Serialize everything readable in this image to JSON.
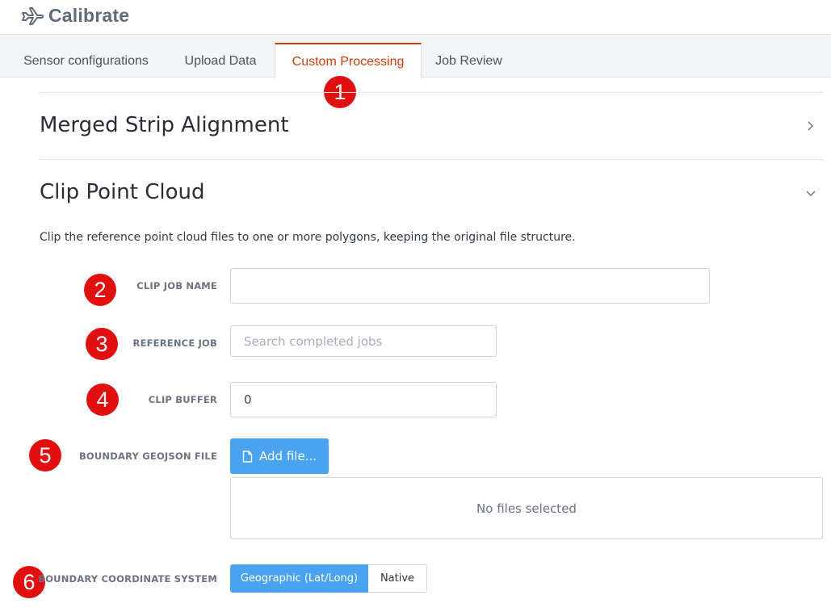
{
  "app": {
    "title": "Calibrate",
    "icon": "plane-icon"
  },
  "tabs": [
    {
      "label": "Sensor configurations",
      "active": false
    },
    {
      "label": "Upload Data",
      "active": false
    },
    {
      "label": "Custom Processing",
      "active": true
    },
    {
      "label": "Job Review",
      "active": false
    }
  ],
  "badges": [
    "1",
    "2",
    "3",
    "4",
    "5",
    "6"
  ],
  "sections": {
    "merged": {
      "title": "Merged Strip Alignment",
      "state": "collapsed"
    },
    "clip": {
      "title": "Clip Point Cloud",
      "state": "expanded",
      "description": "Clip the reference point cloud files to one or more polygons, keeping the original file structure."
    }
  },
  "form": {
    "clip_job_name": {
      "label": "CLIP JOB NAME",
      "value": ""
    },
    "reference_job": {
      "label": "REFERENCE JOB",
      "placeholder": "Search completed jobs",
      "value": ""
    },
    "clip_buffer": {
      "label": "CLIP BUFFER",
      "value": "0"
    },
    "boundary_file": {
      "label": "BOUNDARY GEOJSON FILE",
      "button": "Add file...",
      "empty": "No files selected"
    },
    "coord_system": {
      "label": "BOUNDARY COORDINATE SYSTEM",
      "options": [
        "Geographic (Lat/Long)",
        "Native"
      ],
      "selected": "Geographic (Lat/Long)"
    }
  },
  "colors": {
    "accent": "#4aa3f0",
    "active_tab": "#c8400f",
    "badge": "#e01010"
  }
}
